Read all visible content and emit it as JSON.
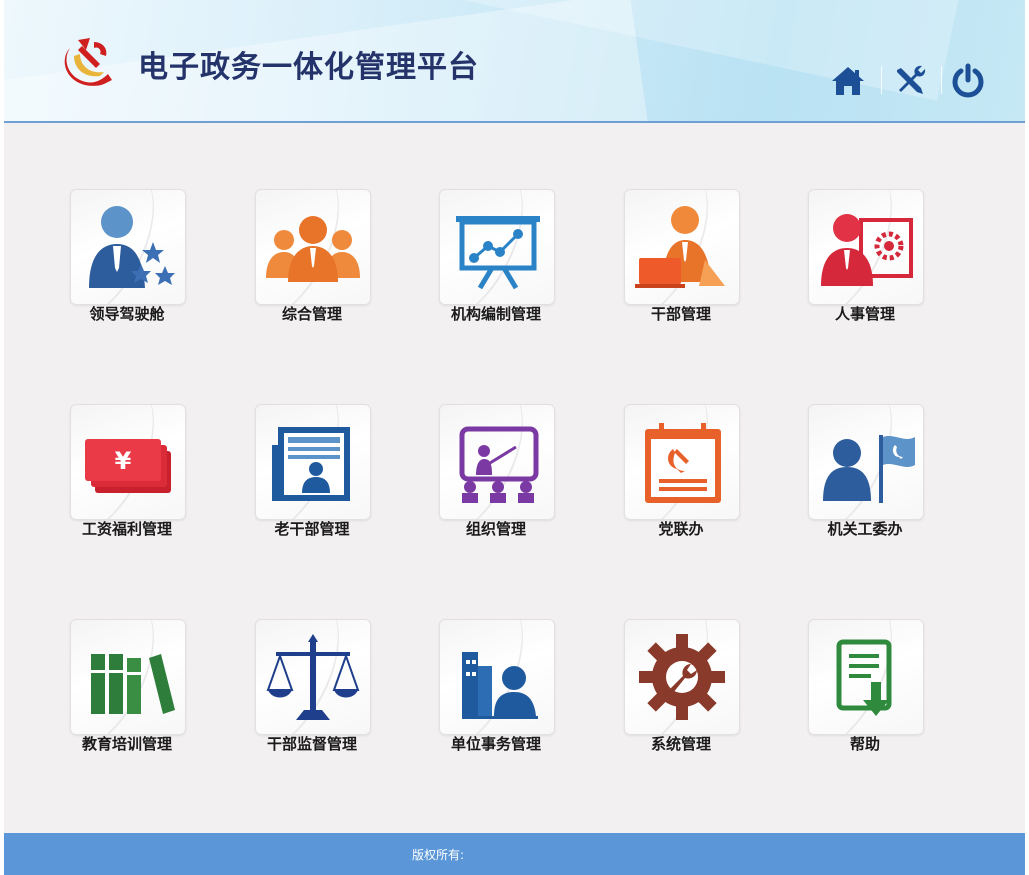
{
  "header": {
    "title": "电子政务一体化管理平台",
    "actions": [
      {
        "name": "home-icon"
      },
      {
        "name": "tools-icon"
      },
      {
        "name": "power-icon"
      }
    ]
  },
  "tiles": [
    {
      "label": "领导驾驶舱",
      "icon": "leader-stars-icon"
    },
    {
      "label": "综合管理",
      "icon": "people-group-icon"
    },
    {
      "label": "机构编制管理",
      "icon": "presentation-board-icon"
    },
    {
      "label": "干部管理",
      "icon": "cadre-laptop-icon"
    },
    {
      "label": "人事管理",
      "icon": "person-gear-icon"
    },
    {
      "label": "工资福利管理",
      "icon": "money-yuan-icon"
    },
    {
      "label": "老干部管理",
      "icon": "newspaper-person-icon"
    },
    {
      "label": "组织管理",
      "icon": "meeting-screen-icon"
    },
    {
      "label": "党联办",
      "icon": "party-calendar-icon"
    },
    {
      "label": "机关工委办",
      "icon": "person-flag-icon"
    },
    {
      "label": "教育培训管理",
      "icon": "books-icon"
    },
    {
      "label": "干部监督管理",
      "icon": "scales-icon"
    },
    {
      "label": "单位事务管理",
      "icon": "building-person-icon"
    },
    {
      "label": "系统管理",
      "icon": "gear-wrench-icon"
    },
    {
      "label": "帮助",
      "icon": "document-arrow-icon"
    }
  ],
  "footer": {
    "copyright": "版权所有:"
  }
}
